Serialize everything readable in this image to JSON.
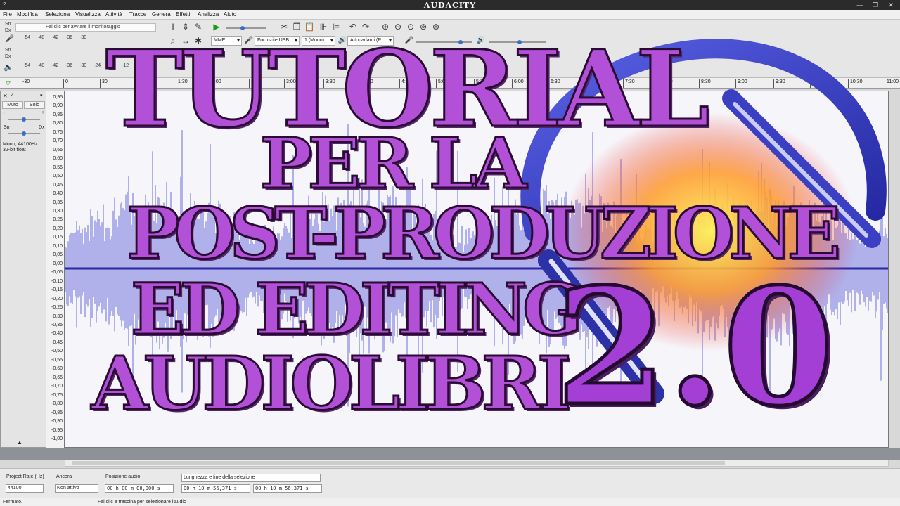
{
  "window": {
    "title": "AUDACITY",
    "icon": "2"
  },
  "menu": [
    "File",
    "Modifica",
    "Seleziona",
    "Visualizza",
    "Attività",
    "Tracce",
    "Genera",
    "Effetti",
    "Analizza",
    "Aiuto"
  ],
  "meters": {
    "record_label_l": "Sn",
    "record_label_r": "Dx",
    "record_hint": "Fai clic per avviare il monitoraggio",
    "play_label_l": "Sn",
    "play_label_r": "Dx",
    "ticks": [
      "-54",
      "-48",
      "-42",
      "-36",
      "-30",
      "-24",
      "-18",
      "-12",
      "-6",
      "0"
    ]
  },
  "devices": {
    "host": "MME",
    "input": "Focusrite USB",
    "channels": "1 (Mono)",
    "output": "Altoparlanti (R"
  },
  "ruler": {
    "ticks": [
      "-30",
      "0",
      "30",
      "1:00",
      "1:30",
      "2:00",
      "2:30",
      "3:00",
      "3:30",
      "4:00",
      "4:30",
      "5:00",
      "5:30",
      "6:00",
      "6:30",
      "7:00",
      "7:30",
      "8:00",
      "8:30",
      "9:00",
      "9:30",
      "10:00",
      "10:30",
      "11:00"
    ]
  },
  "track": {
    "name": "2",
    "mute": "Muto",
    "solo": "Solo",
    "pan_l": "Sn",
    "pan_r": "Dx",
    "info_line1": "Mono, 44100Hz",
    "info_line2": "32-bit float"
  },
  "vscale": [
    "0,95",
    "0,90",
    "0,85",
    "0,80",
    "0,75",
    "0,70",
    "0,65",
    "0,60",
    "0,55",
    "0,50",
    "0,45",
    "0,40",
    "0,35",
    "0,30",
    "0,25",
    "0,20",
    "0,15",
    "0,10",
    "0,05",
    "0,00",
    "-0,05",
    "-0,10",
    "-0,15",
    "-0,20",
    "-0,25",
    "-0,30",
    "-0,35",
    "-0,40",
    "-0,45",
    "-0,50",
    "-0,55",
    "-0,60",
    "-0,65",
    "-0,70",
    "-0,75",
    "-0,80",
    "-0,85",
    "-0,90",
    "-0,95",
    "-1,00"
  ],
  "selection": {
    "rate_label": "Project Rate (Hz)",
    "rate_value": "44100",
    "snap_label": "Ancora",
    "snap_value": "Non attivo",
    "pos_label": "Posizione audio",
    "pos_value": "00 h 00 m 00,000 s",
    "sel_label": "Lunghezza e fine della selezione",
    "sel_start": "00 h 10 m 56,371 s",
    "sel_end": "00 h 10 m 56,371 s"
  },
  "status": {
    "left": "Fermato.",
    "center": "Fai clic e trascina per selezionare l'audio"
  },
  "overlay": {
    "line1": "TUTORIAL",
    "line2": "PER LA",
    "line3": "POST-PRODUZIONE",
    "line4": "ED EDITING",
    "line5": "AUDIOLIBRI",
    "version": "2.0"
  },
  "colors": {
    "waveform": "#3a3ad0",
    "headphones": "#3b3fc2",
    "title_fill": "#b250d8"
  }
}
